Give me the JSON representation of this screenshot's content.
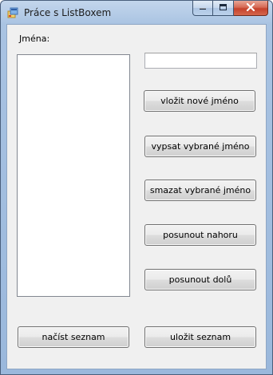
{
  "window": {
    "title": "Práce s ListBoxem",
    "caption_buttons": [
      "minimize",
      "maximize",
      "close"
    ]
  },
  "form": {
    "names_label": "Jména:",
    "name_input": {
      "value": "",
      "placeholder": ""
    },
    "names_list": []
  },
  "buttons": {
    "insert_new_name": "vložit nové jméno",
    "print_selected_name": "vypsat vybrané jméno",
    "delete_selected_name": "smazat vybrané jméno",
    "move_up": "posunout nahoru",
    "move_down": "posunout dolů",
    "load_list": "načíst seznam",
    "save_list": "uložit seznam"
  },
  "icons": {
    "app": "form-app-icon",
    "minimize": "minimize-icon",
    "maximize": "maximize-icon",
    "close": "close-icon"
  },
  "colors": {
    "form_background": "#f0f0f0",
    "frame": "#a9c3e2",
    "close_button": "#c5412b"
  }
}
